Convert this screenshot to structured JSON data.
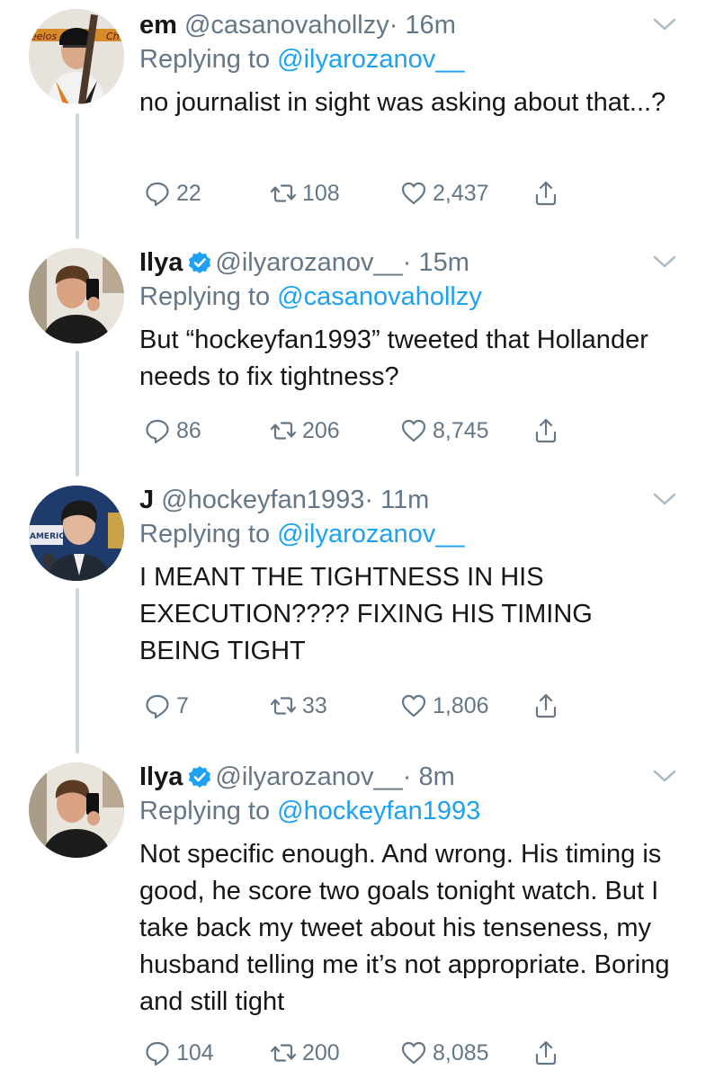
{
  "tweets": [
    {
      "name": "em",
      "handle": "@casanovahollzy",
      "time": "· 16m",
      "verified": false,
      "replying_prefix": "Replying to",
      "replying_to": "@ilyarozanov__",
      "text": "no journalist in sight was asking about that...?",
      "replies": "22",
      "retweets": "108",
      "likes": "2,437",
      "avatar": "avatar-hockey-player"
    },
    {
      "name": "Ilya",
      "handle": "@ilyarozanov__",
      "time": "· 15m",
      "verified": true,
      "replying_prefix": "Replying to",
      "replying_to": "@casanovahollzy",
      "text": "But “hockeyfan1993” tweeted that Hollander needs to fix tightness?",
      "replies": "86",
      "retweets": "206",
      "likes": "8,745",
      "avatar": "avatar-mirror-selfie"
    },
    {
      "name": "J",
      "handle": "@hockeyfan1993",
      "time": "· 11m",
      "verified": false,
      "replying_prefix": "Replying to",
      "replying_to": "@ilyarozanov__",
      "text": "I MEANT THE TIGHTNESS IN HIS EXECUTION???? FIXING HIS TIMING BEING TIGHT",
      "replies": "7",
      "retweets": "33",
      "likes": "1,806",
      "avatar": "avatar-press-conference",
      "avatar_text": "AMERICA"
    },
    {
      "name": "Ilya",
      "handle": "@ilyarozanov__",
      "time": "· 8m",
      "verified": true,
      "replying_prefix": "Replying to",
      "replying_to": "@hockeyfan1993",
      "text": "Not specific enough. And wrong. His timing is good, he score two goals tonight watch. But I take back my tweet about his tenseness, my husband telling me it’s not appropriate. Boring and still tight",
      "replies": "104",
      "retweets": "200",
      "likes": "8,085",
      "avatar": "avatar-mirror-selfie"
    }
  ],
  "colors": {
    "text": "#14171a",
    "secondary": "#657786",
    "link": "#1da1f2",
    "thread_line": "#ccd6dd",
    "verified": "#1da1f2"
  },
  "icons": [
    "reply-icon",
    "retweet-icon",
    "like-icon",
    "share-icon",
    "chevron-down-icon",
    "verified-badge-icon"
  ]
}
